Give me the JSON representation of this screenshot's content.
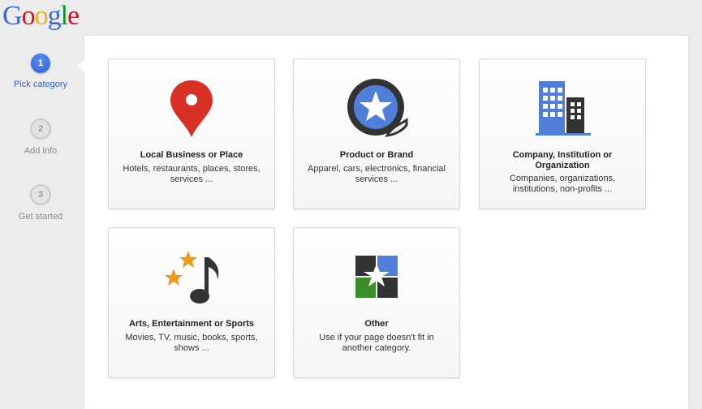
{
  "logo": {
    "letters": [
      "G",
      "o",
      "o",
      "g",
      "l",
      "e"
    ],
    "colors": [
      "#3369e8",
      "#d50f25",
      "#eeb211",
      "#3369e8",
      "#009925",
      "#d50f25"
    ]
  },
  "steps": [
    {
      "number": "1",
      "label": "Pick category",
      "state": "active"
    },
    {
      "number": "2",
      "label": "Add info",
      "state": "inactive"
    },
    {
      "number": "3",
      "label": "Get started",
      "state": "inactive"
    }
  ],
  "categories": [
    {
      "title": "Local Business or Place",
      "description": "Hotels, restaurants, places, stores, services ...",
      "icon": "map-pin-icon"
    },
    {
      "title": "Product or Brand",
      "description": "Apparel, cars, electronics, financial services ...",
      "icon": "star-sticker-icon"
    },
    {
      "title": "Company, Institution or Organization",
      "description": "Companies, organizations, institutions, non-profits ...",
      "icon": "buildings-icon"
    },
    {
      "title": "Arts, Entertainment or Sports",
      "description": "Movies, TV, music, books, sports, shows ...",
      "icon": "music-note-stars-icon"
    },
    {
      "title": "Other",
      "description": "Use if your page doesn't fit in another category.",
      "icon": "puzzle-icon"
    }
  ],
  "colors": {
    "accent": "#2a63d6",
    "pin_red": "#d93025",
    "blue": "#4f7fd9",
    "dark": "#333333",
    "star_orange": "#f09a1a",
    "green": "#3a8f2a"
  }
}
